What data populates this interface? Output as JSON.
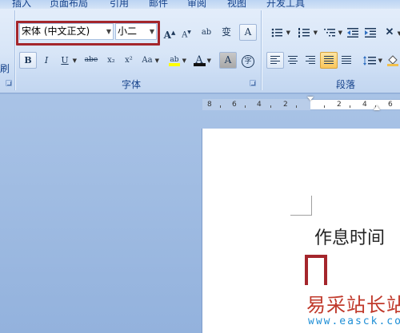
{
  "tabs": [
    {
      "label": "插入"
    },
    {
      "label": "页面布局"
    },
    {
      "label": "引用"
    },
    {
      "label": "邮件"
    },
    {
      "label": "审阅"
    },
    {
      "label": "视图"
    },
    {
      "label": "开发工具"
    }
  ],
  "clipboard": {
    "format_painter_label": "刷"
  },
  "font_group": {
    "label": "字体",
    "font_name": "宋体 (中文正文)",
    "font_size": "小二",
    "grow_font": "A",
    "shrink_font": "A",
    "clear_format": "ab",
    "phonetic_guide": "变",
    "char_border": "A",
    "bold": "B",
    "italic": "I",
    "underline": "U",
    "strikethrough": "abe",
    "subscript": "x₂",
    "superscript": "x²",
    "change_case": "Aa",
    "highlight": "ab",
    "font_color": "A",
    "char_shading": "A",
    "enclose_char": "字"
  },
  "paragraph_group": {
    "label": "段落"
  },
  "ruler": {
    "ticks": [
      "8",
      "6",
      "4",
      "2",
      "2",
      "4",
      "6"
    ]
  },
  "document": {
    "text": "作息时间"
  },
  "watermark": {
    "text": "易采站长站",
    "url": "www.easck.com"
  },
  "colors": {
    "annotation": "#a4262c",
    "ribbon_text": "#15428b",
    "watermark_red": "#c0392b",
    "watermark_blue": "#1f8fd6"
  }
}
